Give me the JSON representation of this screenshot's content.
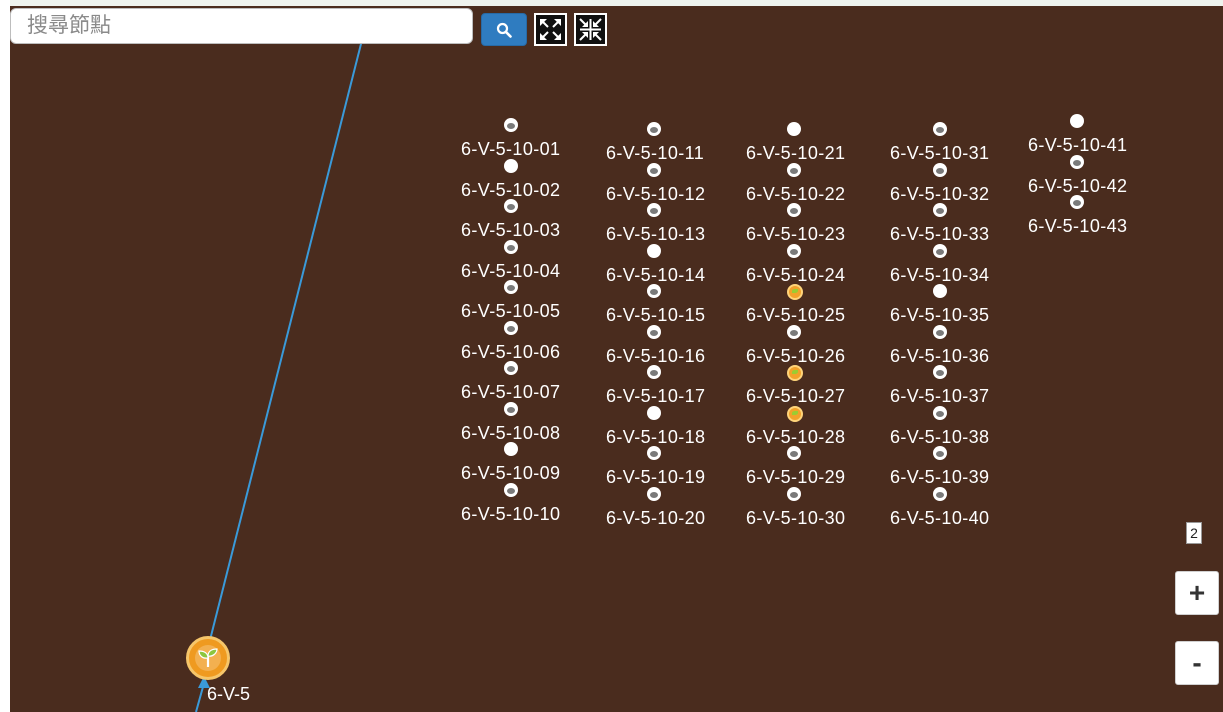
{
  "search": {
    "placeholder": "搜尋節點"
  },
  "toolbar": {
    "search_icon": "magnifier-icon",
    "expand_icon": "expand-arrows-icon",
    "collapse_icon": "collapse-arrows-icon"
  },
  "colors": {
    "canvas_bg": "#4a2c1e",
    "link": "#3a9ad9",
    "accent": "#2f7cc0",
    "node_leaf": "#f2a22a"
  },
  "root": {
    "label": "6-V-5",
    "icon": "sprout-icon"
  },
  "nodes": [
    {
      "label": "6-V-5-10-01",
      "state": "ring"
    },
    {
      "label": "6-V-5-10-02",
      "state": "solid"
    },
    {
      "label": "6-V-5-10-03",
      "state": "ring"
    },
    {
      "label": "6-V-5-10-04",
      "state": "ring"
    },
    {
      "label": "6-V-5-10-05",
      "state": "ring"
    },
    {
      "label": "6-V-5-10-06",
      "state": "ring"
    },
    {
      "label": "6-V-5-10-07",
      "state": "ring"
    },
    {
      "label": "6-V-5-10-08",
      "state": "ring"
    },
    {
      "label": "6-V-5-10-09",
      "state": "solid"
    },
    {
      "label": "6-V-5-10-10",
      "state": "ring"
    },
    {
      "label": "6-V-5-10-11",
      "state": "ring"
    },
    {
      "label": "6-V-5-10-12",
      "state": "ring"
    },
    {
      "label": "6-V-5-10-13",
      "state": "ring"
    },
    {
      "label": "6-V-5-10-14",
      "state": "solid"
    },
    {
      "label": "6-V-5-10-15",
      "state": "ring"
    },
    {
      "label": "6-V-5-10-16",
      "state": "ring"
    },
    {
      "label": "6-V-5-10-17",
      "state": "ring"
    },
    {
      "label": "6-V-5-10-18",
      "state": "solid"
    },
    {
      "label": "6-V-5-10-19",
      "state": "ring"
    },
    {
      "label": "6-V-5-10-20",
      "state": "ring"
    },
    {
      "label": "6-V-5-10-21",
      "state": "solid"
    },
    {
      "label": "6-V-5-10-22",
      "state": "ring"
    },
    {
      "label": "6-V-5-10-23",
      "state": "ring"
    },
    {
      "label": "6-V-5-10-24",
      "state": "ring"
    },
    {
      "label": "6-V-5-10-25",
      "state": "leaf"
    },
    {
      "label": "6-V-5-10-26",
      "state": "ring"
    },
    {
      "label": "6-V-5-10-27",
      "state": "leaf"
    },
    {
      "label": "6-V-5-10-28",
      "state": "leaf"
    },
    {
      "label": "6-V-5-10-29",
      "state": "ring"
    },
    {
      "label": "6-V-5-10-30",
      "state": "ring"
    },
    {
      "label": "6-V-5-10-31",
      "state": "ring"
    },
    {
      "label": "6-V-5-10-32",
      "state": "ring"
    },
    {
      "label": "6-V-5-10-33",
      "state": "ring"
    },
    {
      "label": "6-V-5-10-34",
      "state": "ring"
    },
    {
      "label": "6-V-5-10-35",
      "state": "solid"
    },
    {
      "label": "6-V-5-10-36",
      "state": "ring"
    },
    {
      "label": "6-V-5-10-37",
      "state": "ring"
    },
    {
      "label": "6-V-5-10-38",
      "state": "ring"
    },
    {
      "label": "6-V-5-10-39",
      "state": "ring"
    },
    {
      "label": "6-V-5-10-40",
      "state": "ring"
    },
    {
      "label": "6-V-5-10-41",
      "state": "solid"
    },
    {
      "label": "6-V-5-10-42",
      "state": "ring"
    },
    {
      "label": "6-V-5-10-43",
      "state": "ring"
    }
  ],
  "zoom": {
    "level": "2",
    "in_label": "+",
    "out_label": "-"
  }
}
